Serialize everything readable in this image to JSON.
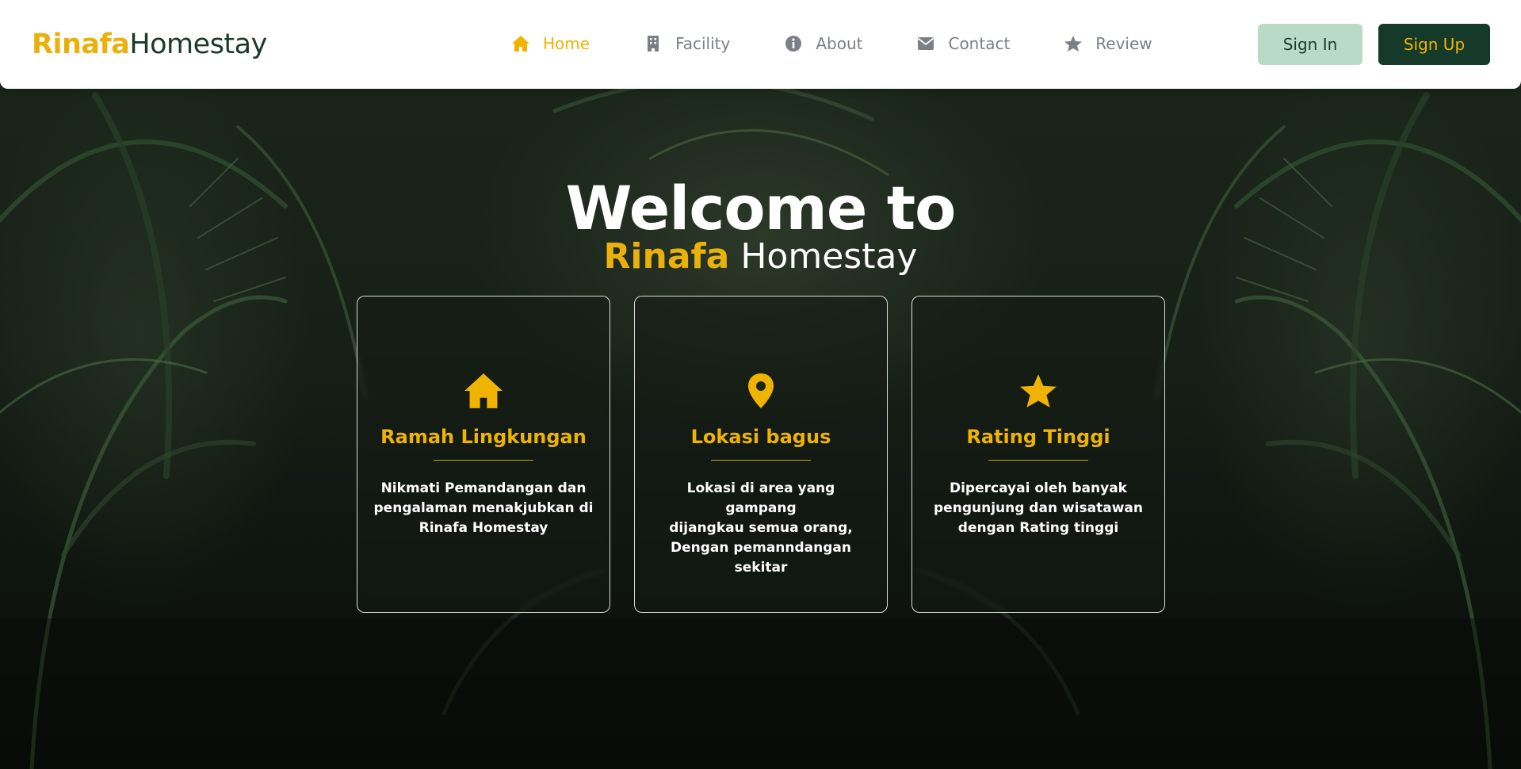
{
  "header": {
    "logo_brand": "Rinafa",
    "logo_rest": "Homestay",
    "nav": [
      {
        "label": "Home",
        "icon": "home-icon",
        "active": true
      },
      {
        "label": "Facility",
        "icon": "building-icon",
        "active": false
      },
      {
        "label": "About",
        "icon": "info-icon",
        "active": false
      },
      {
        "label": "Contact",
        "icon": "envelope-icon",
        "active": false
      },
      {
        "label": "Review",
        "icon": "star-icon",
        "active": false
      }
    ],
    "signin_label": "Sign In",
    "signup_label": "Sign Up"
  },
  "hero": {
    "title": "Welcome to",
    "subtitle_brand": "Rinafa",
    "subtitle_rest": "Homestay"
  },
  "cards": [
    {
      "icon": "home-icon",
      "title": "Ramah Lingkungan",
      "text": "Nikmati Pemandangan dan\npengalaman menakjubkan di\nRinafa Homestay"
    },
    {
      "icon": "map-pin-icon",
      "title": "Lokasi bagus",
      "text": "Lokasi di area yang gampang\ndijangkau semua orang,\nDengan pemanndangan sekitar"
    },
    {
      "icon": "star-icon",
      "title": "Rating Tinggi",
      "text": "Dipercayai oleh banyak\npengunjung dan wisatawan\ndengan Rating tinggi"
    }
  ],
  "colors": {
    "accent": "#f0b400",
    "brand_dark": "#163a29",
    "signin_bg": "#b8dac7",
    "nav_text": "#7b7f86"
  }
}
